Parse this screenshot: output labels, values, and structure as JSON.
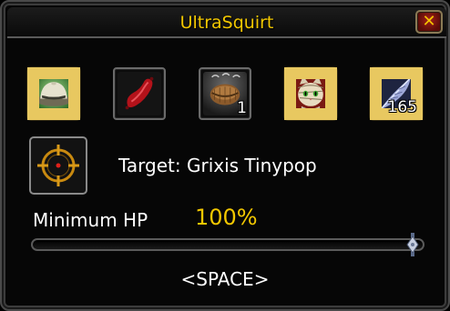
{
  "window": {
    "title": "UltraSquirt",
    "close_glyph": "✕"
  },
  "slots": [
    {
      "icon": "pith-helmet-icon",
      "count": "",
      "border": "gold"
    },
    {
      "icon": "sausage-icon",
      "count": "",
      "border": "plain"
    },
    {
      "icon": "wooden-bucket-icon",
      "count": "1",
      "border": "plain"
    },
    {
      "icon": "cat-portrait-icon",
      "count": "",
      "border": "gold"
    },
    {
      "icon": "silver-feather-icon",
      "count": "165",
      "border": "gold"
    }
  ],
  "target": {
    "icon": "crosshair-icon",
    "text": "Target: Grixis Tinypop"
  },
  "min_hp": {
    "label": "Minimum HP",
    "value_text": "100%",
    "value": 1.0
  },
  "keybind_hint": "<SPACE>",
  "colors": {
    "title": "#f2c700",
    "value": "#f2c700",
    "gold_border": "#c9a23a",
    "close_bg": "#a3201a"
  }
}
